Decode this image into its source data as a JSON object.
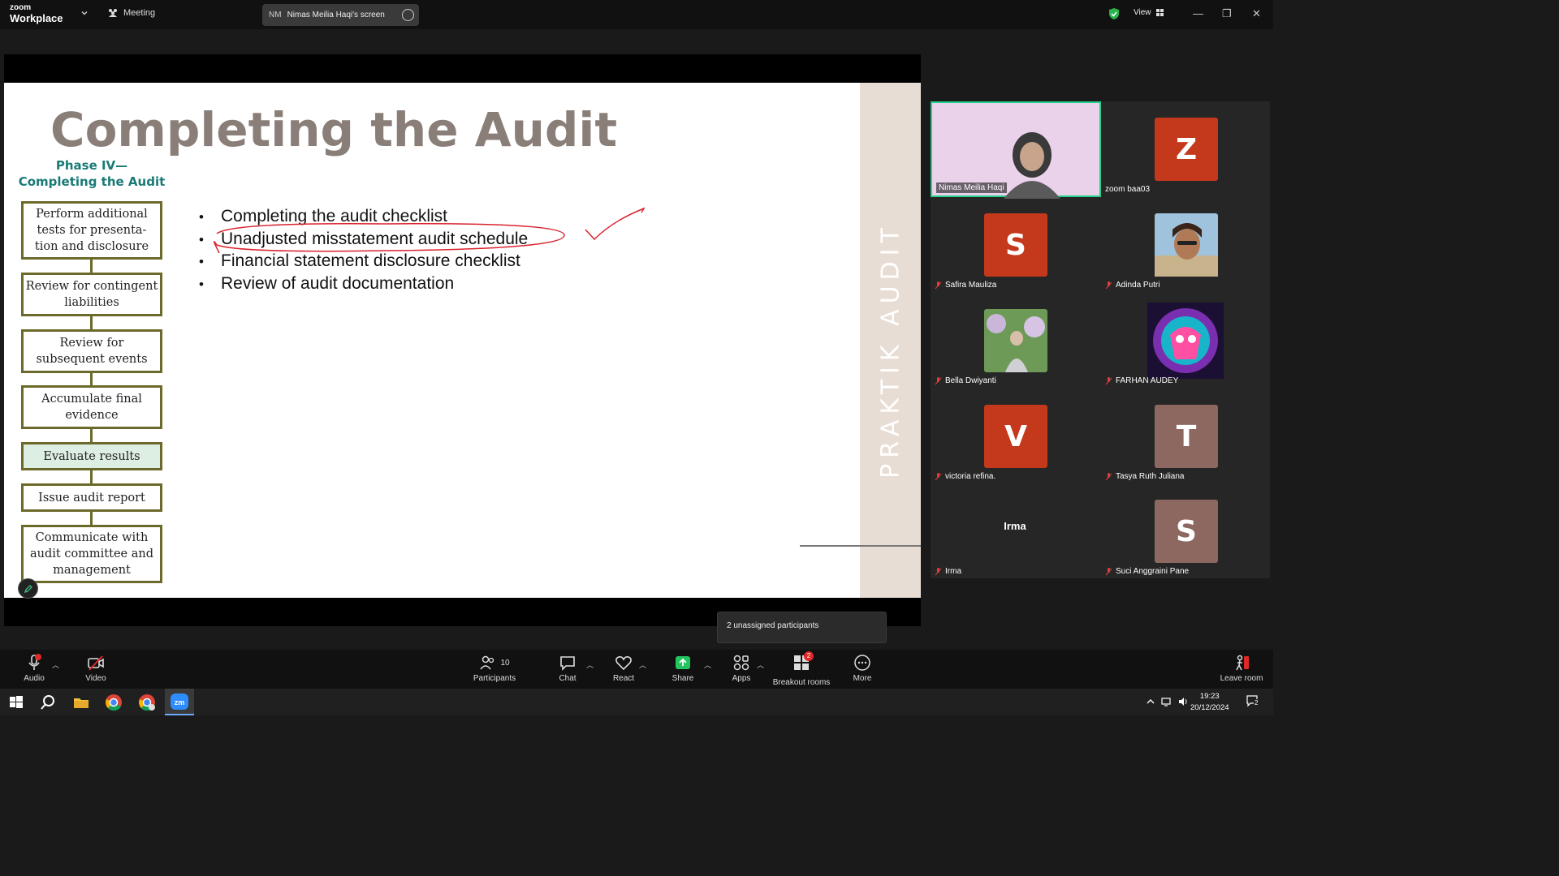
{
  "titlebar": {
    "logo_small": "zoom",
    "logo_big": "Workplace",
    "meeting_label": "Meeting",
    "screen_initials": "NM",
    "screen_label": "Nimas Meilia Haqi's screen",
    "view_label": "View",
    "minimize": "—",
    "maximize": "❐",
    "close": "✕"
  },
  "slide": {
    "title": "Completing the Audit",
    "phase_line1": "Phase IV—",
    "phase_line2": "Completing the Audit",
    "flow": [
      "Perform additional tests for presenta- tion and disclosure",
      "Review for contingent liabilities",
      "Review for subsequent events",
      "Accumulate final evidence",
      "Evaluate results",
      "Issue audit report",
      "Communicate with audit committee and management"
    ],
    "bullets": [
      "Completing the audit checklist",
      "Unadjusted misstatement audit schedule",
      "Financial statement disclosure checklist",
      "Review of audit documentation"
    ],
    "side_text": "PRAKTIK   AUDIT"
  },
  "participants": [
    {
      "name": "Nimas Meilia Haqi",
      "initial": "",
      "color": "",
      "muted": false,
      "kind": "video"
    },
    {
      "name": "zoom baa03",
      "initial": "Z",
      "color": "#c4391b",
      "muted": false,
      "kind": "avatar"
    },
    {
      "name": "Safira Mauliza",
      "initial": "S",
      "color": "#c4391b",
      "muted": true,
      "kind": "avatar"
    },
    {
      "name": "Adinda Putri",
      "initial": "",
      "color": "#8fb6d4",
      "muted": true,
      "kind": "photo"
    },
    {
      "name": "Bella Dwiyanti",
      "initial": "",
      "color": "#7ea36a",
      "muted": true,
      "kind": "photo"
    },
    {
      "name": "FARHAN AUDEY",
      "initial": "",
      "color": "#5b2a8f",
      "muted": true,
      "kind": "photo"
    },
    {
      "name": "victoria refina.",
      "initial": "V",
      "color": "#c4391b",
      "muted": true,
      "kind": "avatar"
    },
    {
      "name": "Tasya Ruth Juliana",
      "initial": "T",
      "color": "#8c6860",
      "muted": true,
      "kind": "avatar"
    },
    {
      "name": "Irma",
      "initial": "",
      "color": "",
      "muted": true,
      "kind": "nameonly",
      "display": "Irma"
    },
    {
      "name": "Suci Anggraini Pane",
      "initial": "S",
      "color": "#8c6860",
      "muted": true,
      "kind": "avatar"
    }
  ],
  "tooltip": "2 unassigned participants",
  "toolbar": {
    "audio": "Audio",
    "video": "Video",
    "participants": "Participants",
    "participants_count": "10",
    "chat": "Chat",
    "react": "React",
    "share": "Share",
    "apps": "Apps",
    "breakout": "Breakout rooms",
    "breakout_badge": "2",
    "more": "More",
    "leave": "Leave room"
  },
  "taskbar": {
    "time": "19:23",
    "date": "20/12/2024",
    "notif": "2"
  },
  "colors": {
    "accent_green": "#23d18b",
    "avatar_orange": "#c4391b",
    "avatar_brown": "#8c6860",
    "flow_border": "#6b6a2a",
    "phase_teal": "#1a7a76",
    "annotation_red": "#d9232e"
  }
}
